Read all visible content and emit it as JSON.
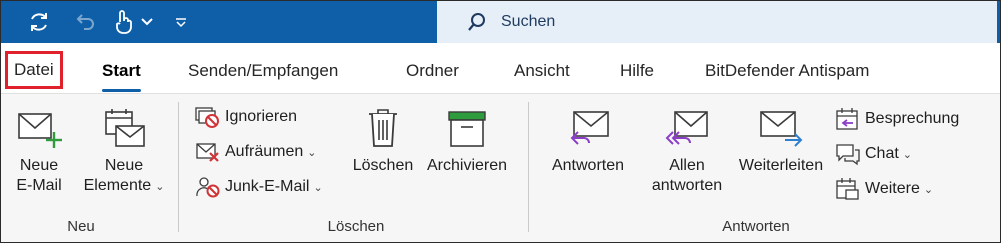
{
  "quick_access": {
    "icons": [
      "sync-icon",
      "undo-icon",
      "touch-mode-icon",
      "chevron-down-icon",
      "customize-icon"
    ]
  },
  "search": {
    "label": "Suchen"
  },
  "tabs": [
    {
      "label": "Datei"
    },
    {
      "label": "Start"
    },
    {
      "label": "Senden/Empfangen"
    },
    {
      "label": "Ordner"
    },
    {
      "label": "Ansicht"
    },
    {
      "label": "Hilfe"
    },
    {
      "label": "BitDefender Antispam"
    }
  ],
  "groups": {
    "neu": {
      "label": "Neu",
      "new_email": {
        "line1": "Neue",
        "line2": "E-Mail"
      },
      "new_items": {
        "line1": "Neue",
        "line2": "Elemente"
      }
    },
    "loeschen": {
      "label": "Löschen",
      "ignore": "Ignorieren",
      "cleanup": "Aufräumen",
      "junk": "Junk-E-Mail",
      "delete": "Löschen",
      "archive": "Archivieren"
    },
    "antworten": {
      "label": "Antworten",
      "reply": "Antworten",
      "reply_all": {
        "line1": "Allen",
        "line2": "antworten"
      },
      "forward": "Weiterleiten",
      "meeting": "Besprechung",
      "chat": "Chat",
      "more": "Weitere"
    }
  },
  "colors": {
    "titlebar": "#0f5fa8",
    "search_bg": "#e6eef8",
    "active_tab_underline": "#0f5fa8",
    "highlight_border": "#e0202b",
    "ribbon_bg": "#f6f6f6",
    "purple_accent": "#8b3fc9",
    "green_accent": "#2e9b3c",
    "blue_accent": "#2f7fd1",
    "red_accent": "#d13438"
  }
}
